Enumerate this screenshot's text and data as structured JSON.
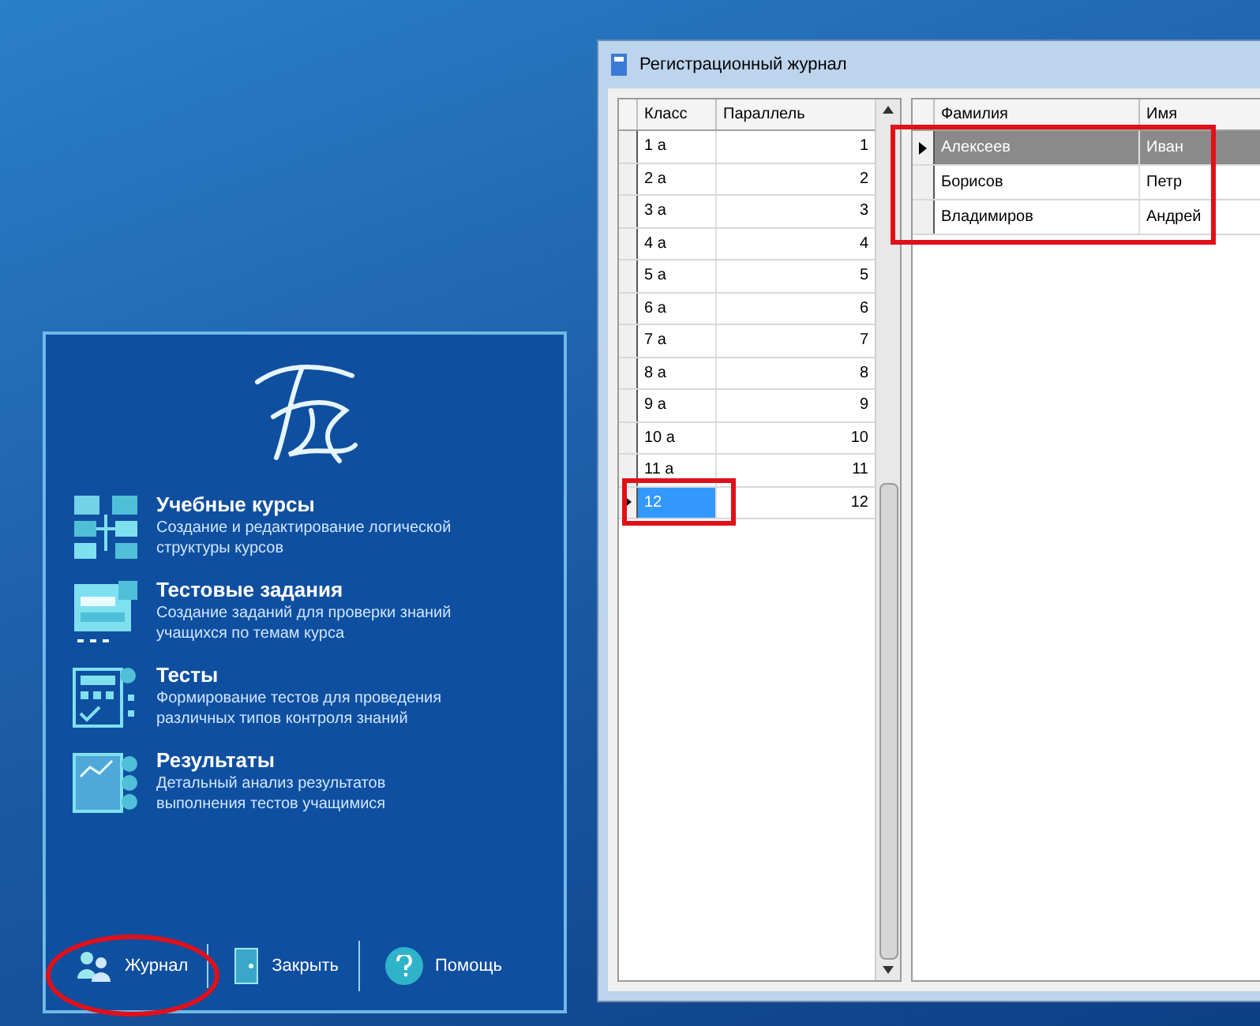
{
  "launcher": {
    "modules": [
      {
        "kind": "courses",
        "title": "Учебные курсы",
        "description": "Создание и редактирование логической структуры курсов"
      },
      {
        "kind": "tasks",
        "title": "Тестовые задания",
        "description": "Создание заданий для проверки знаний учащихся по темам курса"
      },
      {
        "kind": "tests",
        "title": "Тесты",
        "description": "Формирование тестов для проведения различных типов контроля знаний"
      },
      {
        "kind": "results",
        "title": "Результаты",
        "description": "Детальный анализ результатов выполнения тестов учащимися"
      }
    ],
    "buttons": [
      {
        "kind": "journal",
        "label": "Журнал"
      },
      {
        "kind": "close",
        "label": "Закрыть"
      },
      {
        "kind": "help",
        "label": "Помощь"
      }
    ]
  },
  "window": {
    "title": "Регистрационный журнал",
    "class_grid": {
      "columns": [
        "Класс",
        "Параллель"
      ],
      "rows": [
        {
          "class": "1 а",
          "parallel": "1",
          "selected": false
        },
        {
          "class": "2 а",
          "parallel": "2",
          "selected": false
        },
        {
          "class": "3 а",
          "parallel": "3",
          "selected": false
        },
        {
          "class": "4 а",
          "parallel": "4",
          "selected": false
        },
        {
          "class": "5 а",
          "parallel": "5",
          "selected": false
        },
        {
          "class": "6 а",
          "parallel": "6",
          "selected": false
        },
        {
          "class": "7 а",
          "parallel": "7",
          "selected": false
        },
        {
          "class": "8 а",
          "parallel": "8",
          "selected": false
        },
        {
          "class": "9 а",
          "parallel": "9",
          "selected": false
        },
        {
          "class": "10 а",
          "parallel": "10",
          "selected": false
        },
        {
          "class": "11 а",
          "parallel": "11",
          "selected": false
        },
        {
          "class": "12",
          "parallel": "12",
          "selected": true
        }
      ]
    },
    "student_grid": {
      "columns": [
        "Фамилия",
        "Имя"
      ],
      "rows": [
        {
          "surname": "Алексеев",
          "name": "Иван",
          "selected": true
        },
        {
          "surname": "Борисов",
          "name": "Петр",
          "selected": false
        },
        {
          "surname": "Владимиров",
          "name": "Андрей",
          "selected": false
        }
      ]
    }
  }
}
